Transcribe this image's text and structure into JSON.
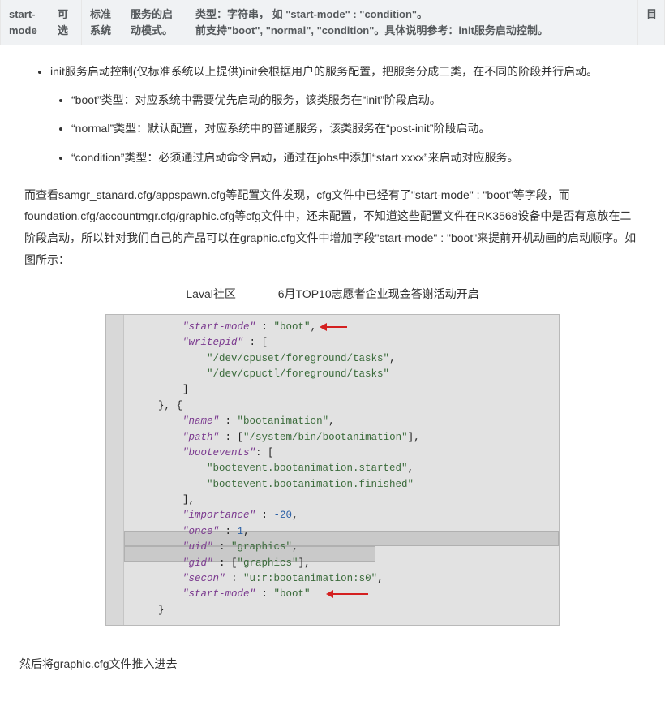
{
  "table": {
    "c1": "start-mode",
    "c2": "可选",
    "c3": "标准系统",
    "c4": "服务的启动模式。",
    "c5_line1": "类型：字符串，  如 \"start-mode\" : \"condition\"。",
    "c5_line2": "前支持\"boot\", \"normal\", \"condition\"。具体说明参考：init服务启动控制。",
    "c6": "目"
  },
  "list": {
    "intro": "init服务启动控制(仅标准系统以上提供)init会根据用户的服务配置，把服务分成三类，在不同的阶段并行启动。",
    "items": [
      "“boot”类型：对应系统中需要优先启动的服务，该类服务在“init”阶段启动。",
      "“normal”类型：默认配置，对应系统中的普通服务，该类服务在“post-init”阶段启动。",
      "“condition”类型：必须通过启动命令启动，通过在jobs中添加“start xxxx”来启动对应服务。"
    ]
  },
  "paragraph1": "而查看samgr_stanard.cfg/appspawn.cfg等配置文件发现，cfg文件中已经有了\"start-mode\" : \"boot\"等字段，而foundation.cfg/accountmgr.cfg/graphic.cfg等cfg文件中，还未配置，不知道这些配置文件在RK3568设备中是否有意放在二阶段启动，所以针对我们自己的产品可以在graphic.cfg文件中增加字段\"start-mode\" : \"boot\"来提前开机动画的启动顺序。如图所示：",
  "promo": {
    "left": "Laval社区",
    "right": "6月TOP10志愿者企业现金答谢活动开启"
  },
  "code": {
    "l01a": "\"start-mode\"",
    "l01b": " : ",
    "l01c": "\"boot\"",
    "l01d": ",",
    "l02a": "\"writepid\"",
    "l02b": " : [",
    "l03": "\"/dev/cpuset/foreground/tasks\"",
    "l03b": ",",
    "l04": "\"/dev/cpuctl/foreground/tasks\"",
    "l05": "]",
    "l06": "}, {",
    "l07a": "\"name\"",
    "l07b": " : ",
    "l07c": "\"bootanimation\"",
    "l07d": ",",
    "l08a": "\"path\"",
    "l08b": " : [",
    "l08c": "\"/system/bin/bootanimation\"",
    "l08d": "],",
    "l09a": "\"bootevents\"",
    "l09b": ": [",
    "l10": "\"bootevent.bootanimation.started\"",
    "l10b": ",",
    "l11": "\"bootevent.bootanimation.finished\"",
    "l12": "],",
    "l13a": "\"importance\"",
    "l13b": " : ",
    "l13c": "-20",
    "l13d": ",",
    "l14a": "\"once\"",
    "l14b": " : ",
    "l14c": "1",
    "l14d": ",",
    "l15a": "\"uid\"",
    "l15b": " : ",
    "l15c": "\"graphics\"",
    "l15d": ",",
    "l16a": "\"gid\"",
    "l16b": " : [",
    "l16c": "\"graphics\"",
    "l16d": "],",
    "l17a": "\"secon\"",
    "l17b": " : ",
    "l17c": "\"u:r:bootanimation:s0\"",
    "l17d": ",",
    "l18a": "\"start-mode\"",
    "l18b": " : ",
    "l18c": "\"boot\"",
    "l19": "}"
  },
  "paragraph2": "然后将graphic.cfg文件推入进去"
}
